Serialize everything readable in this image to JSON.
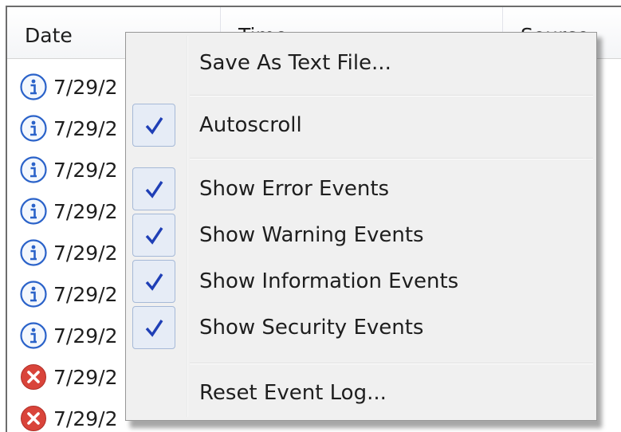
{
  "list": {
    "columns": [
      "Date",
      "Time",
      "Source"
    ],
    "rows": [
      {
        "type": "info",
        "date": "7/29/2"
      },
      {
        "type": "info",
        "date": "7/29/2"
      },
      {
        "type": "info",
        "date": "7/29/2"
      },
      {
        "type": "info",
        "date": "7/29/2"
      },
      {
        "type": "info",
        "date": "7/29/2"
      },
      {
        "type": "info",
        "date": "7/29/2"
      },
      {
        "type": "info",
        "date": "7/29/2"
      },
      {
        "type": "error",
        "date": "7/29/2"
      },
      {
        "type": "error",
        "date": "7/29/2"
      }
    ]
  },
  "menu": {
    "items": [
      {
        "label": "Save As Text File...",
        "checked": false
      },
      {
        "label": "Autoscroll",
        "checked": true
      },
      {
        "label": "Show Error Events",
        "checked": true
      },
      {
        "label": "Show Warning Events",
        "checked": true
      },
      {
        "label": "Show Information Events",
        "checked": true
      },
      {
        "label": "Show Security Events",
        "checked": true
      },
      {
        "label": "Reset Event Log...",
        "checked": false
      }
    ]
  },
  "colors": {
    "info_icon": "#2a62c9",
    "error_icon": "#d9443a",
    "check": "#1f3fb6",
    "menu_bg": "#f0f0f0"
  },
  "icons": {
    "info": "info-icon",
    "error": "error-icon",
    "check": "checkmark-icon"
  }
}
